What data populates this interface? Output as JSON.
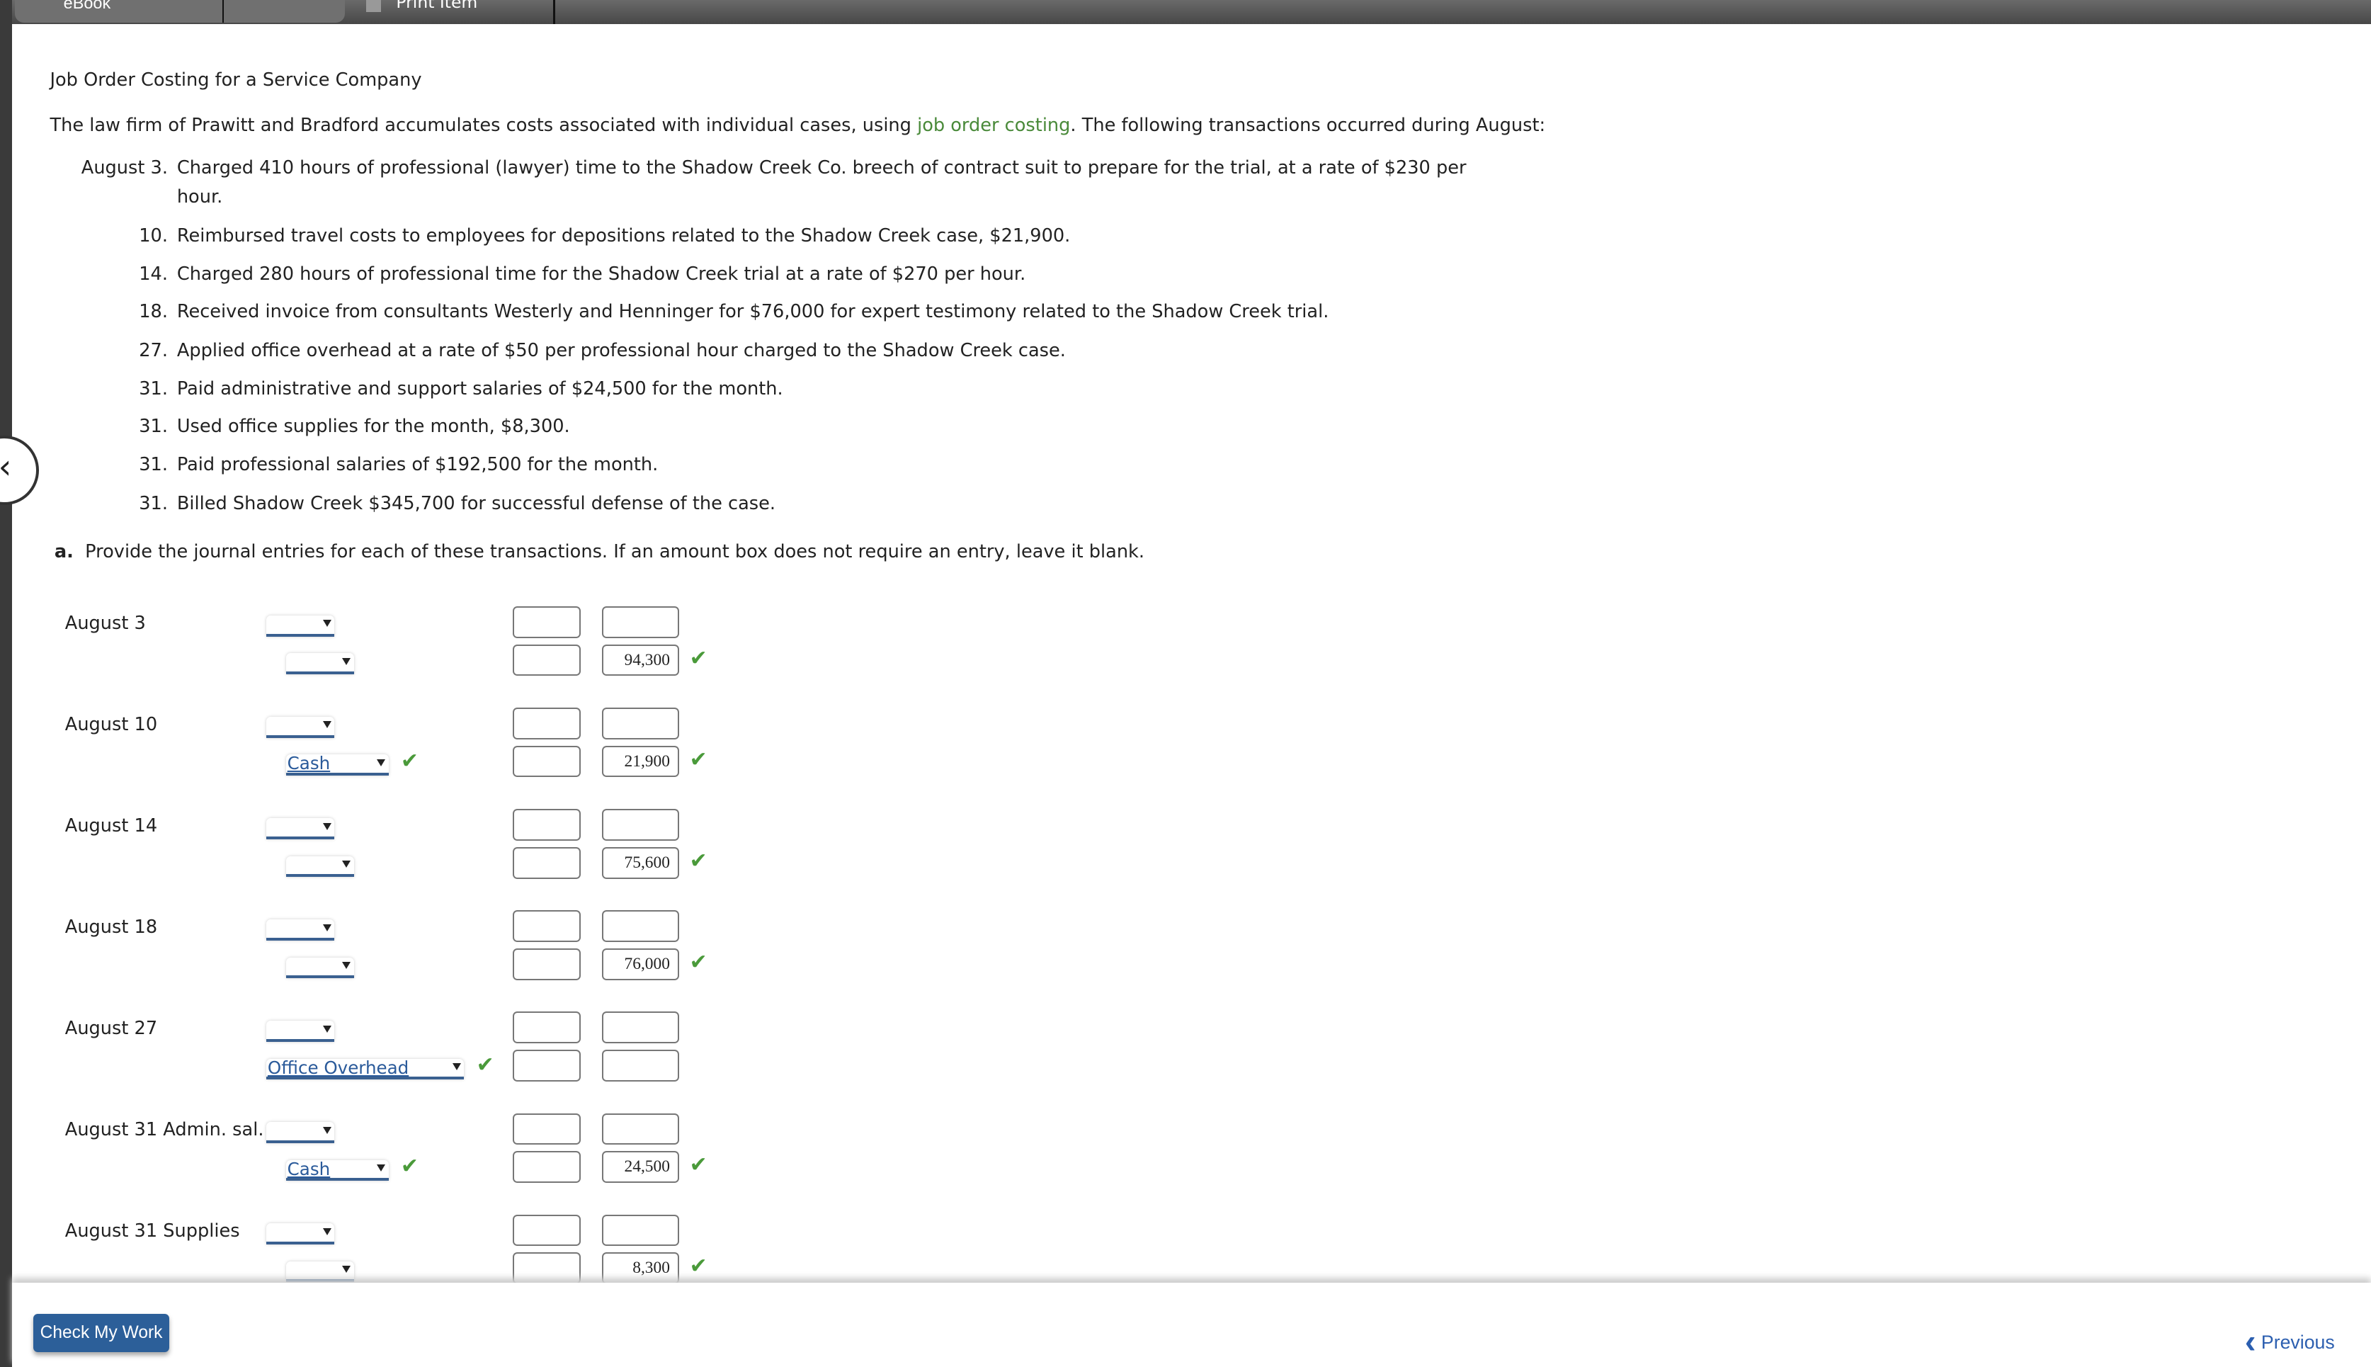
{
  "tabs": {
    "ebook": "eBook",
    "print": "Print Item"
  },
  "title": "Job Order Costing for a Service Company",
  "intro": {
    "before": "The law firm of Prawitt and Bradford accumulates costs associated with individual cases, using ",
    "link": "job order costing",
    "after": ". The following transactions occurred during August:"
  },
  "transactions": [
    {
      "date": "August 3.",
      "text": "Charged 410 hours of professional (lawyer) time to the Shadow Creek Co. breech of contract suit to prepare for the trial, at a rate of $230 per",
      "cont": "hour."
    },
    {
      "date": "10.",
      "text": "Reimbursed travel costs to employees for depositions related to the Shadow Creek case, $21,900."
    },
    {
      "date": "14.",
      "text": "Charged 280 hours of professional time for the Shadow Creek trial at a rate of $270 per hour."
    },
    {
      "date": "18.",
      "text": "Received invoice from consultants Westerly and Henninger for $76,000 for expert testimony related to the Shadow Creek trial."
    },
    {
      "date": "27.",
      "text": "Applied office overhead at a rate of $50 per professional hour charged to the Shadow Creek case."
    },
    {
      "date": "31.",
      "text": "Paid administrative and support salaries of $24,500 for the month."
    },
    {
      "date": "31.",
      "text": "Used office supplies for the month, $8,300."
    },
    {
      "date": "31.",
      "text": "Paid professional salaries of $192,500 for the month."
    },
    {
      "date": "31.",
      "text": "Billed Shadow Creek $345,700 for successful defense of the case."
    }
  ],
  "instruction": {
    "label": "a.",
    "text": "Provide the journal entries for each of these transactions. If an amount box does not require an entry, leave it blank."
  },
  "entries": [
    {
      "label": "August 3",
      "account2": "",
      "credit2": "94,300",
      "ok_account": false,
      "ok_amount": true
    },
    {
      "label": "August 10",
      "account2": "Cash",
      "credit2": "21,900",
      "ok_account": true,
      "ok_amount": true
    },
    {
      "label": "August 14",
      "account2": "",
      "credit2": "75,600",
      "ok_account": false,
      "ok_amount": true
    },
    {
      "label": "August 18",
      "account2": "",
      "credit2": "76,000",
      "ok_account": false,
      "ok_amount": true
    },
    {
      "label": "August 27",
      "account2": "Office Overhead",
      "credit2": "",
      "ok_account": true,
      "ok_amount": false
    },
    {
      "label": "August 31 Admin. sal.",
      "account2": "Cash",
      "credit2": "24,500",
      "ok_account": true,
      "ok_amount": true
    },
    {
      "label": "August 31 Supplies",
      "account2": "",
      "credit2": "8,300",
      "ok_account": false,
      "ok_amount": true
    }
  ],
  "footer": {
    "check": "Check My Work",
    "previous": "Previous"
  },
  "colors": {
    "accent": "#2c5f99",
    "check": "#4a9a3a",
    "link": "#4a8a3a"
  }
}
